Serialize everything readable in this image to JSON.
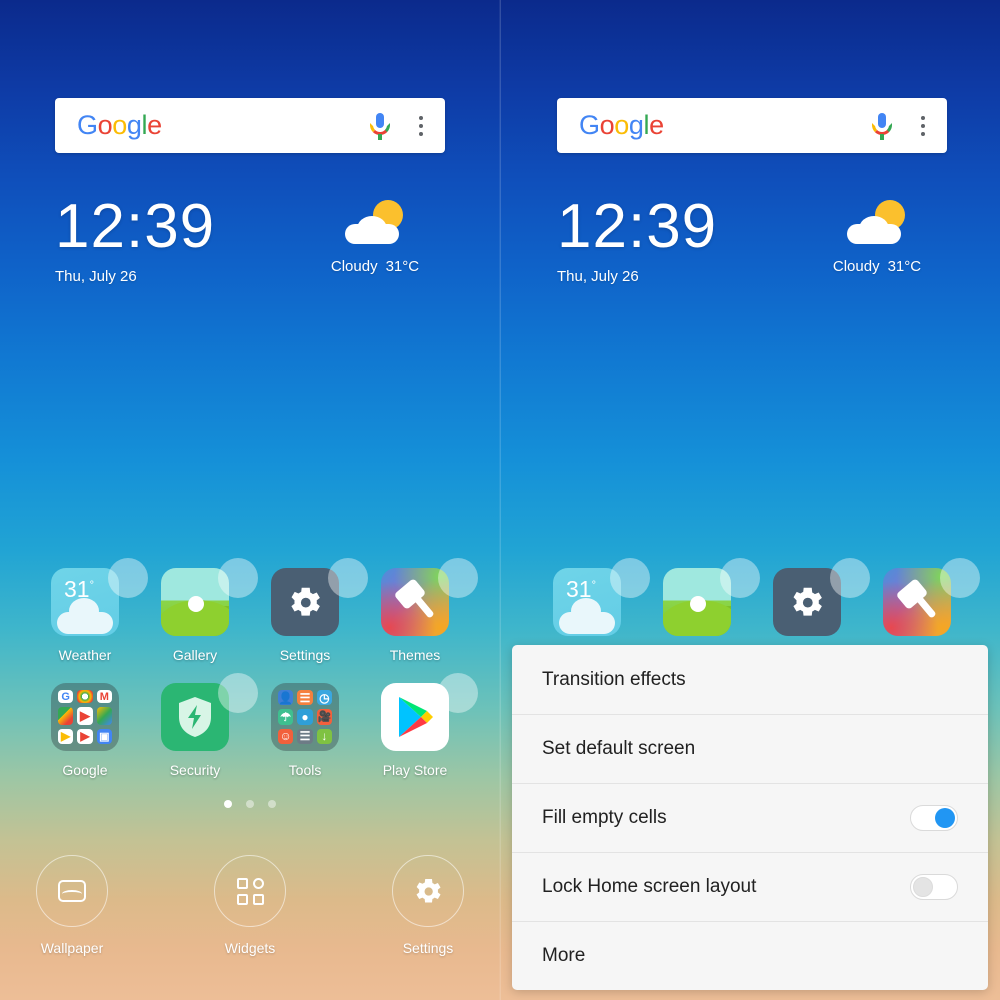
{
  "widgets": {
    "search": {
      "brand": "Google",
      "brand_letters": [
        "G",
        "o",
        "o",
        "g",
        "l",
        "e"
      ],
      "mic_icon": "microphone-icon",
      "overflow_icon": "kebab-menu-icon"
    },
    "clock": {
      "time": "12:39",
      "date": "Thu, July 26"
    },
    "weather": {
      "condition": "Cloudy",
      "temperature": "31°C",
      "icon": "partly-cloudy-icon"
    }
  },
  "home": {
    "rows": [
      [
        {
          "label": "Weather",
          "icon": "weather-app-icon",
          "badge": "31"
        },
        {
          "label": "Gallery",
          "icon": "gallery-app-icon"
        },
        {
          "label": "Settings",
          "icon": "settings-app-icon"
        },
        {
          "label": "Themes",
          "icon": "themes-app-icon"
        }
      ],
      [
        {
          "label": "Google",
          "icon": "google-folder-icon"
        },
        {
          "label": "Security",
          "icon": "security-app-icon"
        },
        {
          "label": "Tools",
          "icon": "tools-folder-icon"
        },
        {
          "label": "Play Store",
          "icon": "play-store-app-icon"
        }
      ]
    ],
    "page_indicator": {
      "count": 3,
      "active": 0
    }
  },
  "edit_dock": {
    "items": [
      {
        "label": "Wallpaper",
        "icon": "wallpaper-icon"
      },
      {
        "label": "Widgets",
        "icon": "widgets-grid-icon"
      },
      {
        "label": "Settings",
        "icon": "gear-icon"
      }
    ]
  },
  "menu": {
    "items": [
      {
        "label": "Transition effects",
        "type": "link"
      },
      {
        "label": "Set default screen",
        "type": "link"
      },
      {
        "label": "Fill empty cells",
        "type": "toggle",
        "value": "on"
      },
      {
        "label": "Lock Home screen layout",
        "type": "toggle",
        "value": "off"
      },
      {
        "label": "More",
        "type": "link"
      }
    ]
  },
  "colors": {
    "accent": "#2196f3",
    "menu_bg": "#f6f6f6",
    "menu_text": "#212121",
    "sky_top": "#0b2a8c",
    "sky_mid": "#21a4d4",
    "sky_bottom": "#edbe97"
  }
}
